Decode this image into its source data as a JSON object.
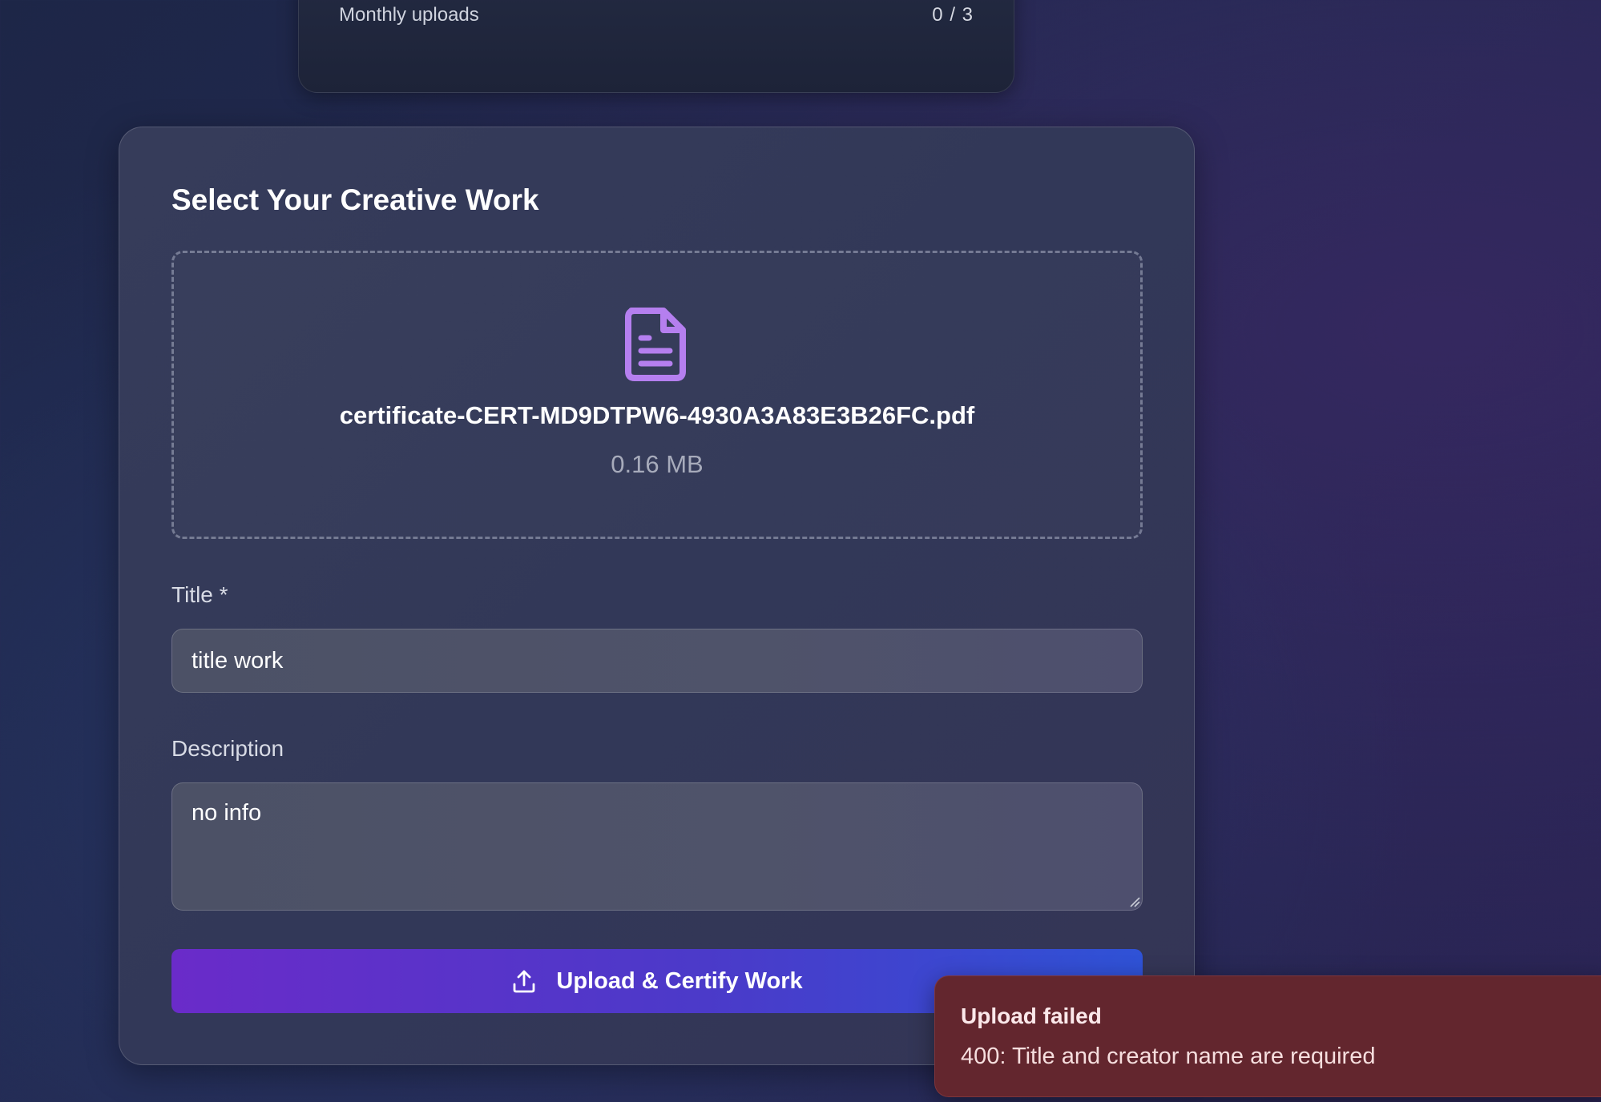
{
  "stats": {
    "monthly_uploads_label": "Monthly uploads",
    "monthly_uploads_value": "0 / 3"
  },
  "upload_card": {
    "title": "Select Your Creative Work",
    "file": {
      "icon": "file-text-icon",
      "name": "certificate-CERT-MD9DTPW6-4930A3A83E3B26FC.pdf",
      "size": "0.16 MB"
    },
    "title_field": {
      "label": "Title *",
      "value": "title work"
    },
    "description_field": {
      "label": "Description",
      "value": "no info"
    },
    "submit_button": {
      "icon": "upload-icon",
      "label": "Upload & Certify Work"
    }
  },
  "toast": {
    "title": "Upload failed",
    "message": "400: Title and creator name are required"
  },
  "colors": {
    "accent_purple": "#6a2bc9",
    "accent_blue": "#2f52d6",
    "file_icon": "#b57fef",
    "toast_background": "#63262e"
  }
}
